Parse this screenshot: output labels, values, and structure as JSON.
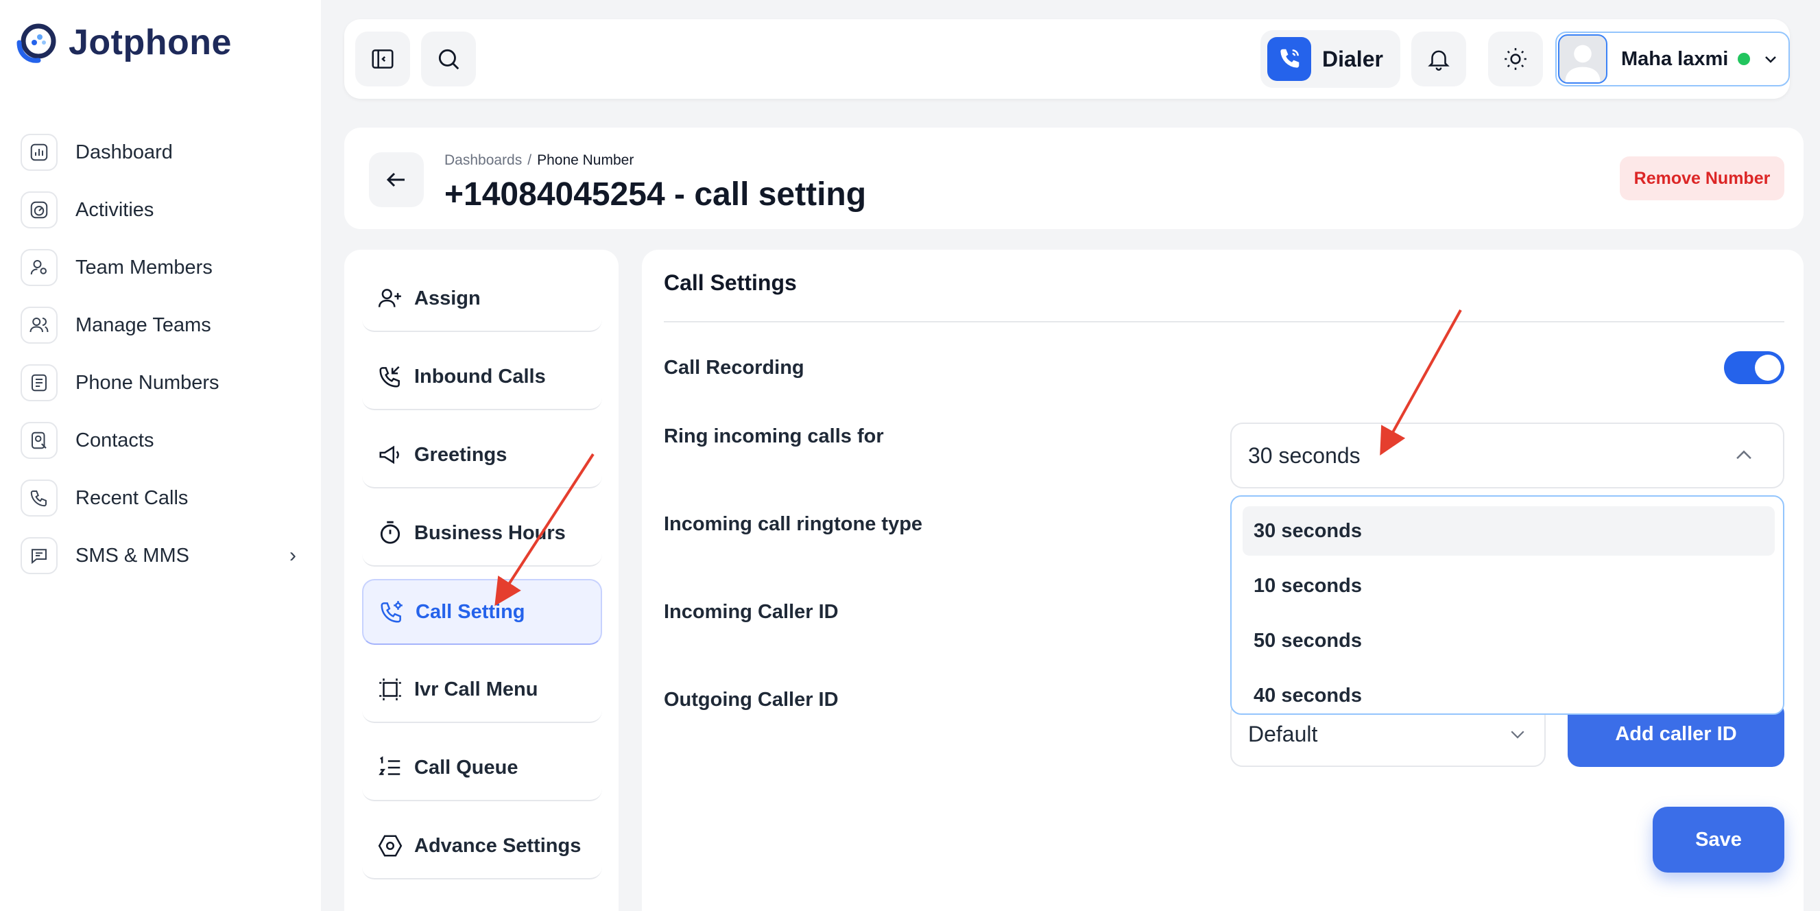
{
  "brand": {
    "name": "Jotphone",
    "accent": "#2563eb"
  },
  "sidebar": {
    "items": [
      {
        "label": "Dashboard",
        "icon": "chart-icon"
      },
      {
        "label": "Activities",
        "icon": "speedometer-icon"
      },
      {
        "label": "Team Members",
        "icon": "user-settings-icon"
      },
      {
        "label": "Manage Teams",
        "icon": "users-icon"
      },
      {
        "label": "Phone Numbers",
        "icon": "phonebook-icon"
      },
      {
        "label": "Contacts",
        "icon": "contact-search-icon"
      },
      {
        "label": "Recent Calls",
        "icon": "phone-history-icon"
      },
      {
        "label": "SMS & MMS",
        "icon": "message-icon"
      }
    ]
  },
  "topbar": {
    "dialer_label": "Dialer",
    "user_name": "Maha laxmi",
    "user_status_color": "#22c55e"
  },
  "header": {
    "breadcrumb_root": "Dashboards",
    "breadcrumb_current": "Phone Number",
    "title": "+14084045254 - call setting",
    "remove_label": "Remove Number"
  },
  "tabs": [
    {
      "label": "Assign",
      "icon": "user-plus-icon"
    },
    {
      "label": "Inbound Calls",
      "icon": "phone-incoming-icon"
    },
    {
      "label": "Greetings",
      "icon": "megaphone-icon"
    },
    {
      "label": "Business Hours",
      "icon": "timer-icon"
    },
    {
      "label": "Call Setting",
      "icon": "phone-gear-icon",
      "active": true
    },
    {
      "label": "Ivr Call Menu",
      "icon": "frame-icon"
    },
    {
      "label": "Call Queue",
      "icon": "numbered-list-icon"
    },
    {
      "label": "Advance Settings",
      "icon": "hexagon-icon"
    }
  ],
  "settings": {
    "title": "Call Settings",
    "call_recording_label": "Call Recording",
    "call_recording_on": true,
    "ring_label": "Ring incoming calls for",
    "ring_value": "30 seconds",
    "ringtone_label": "Incoming call ringtone type",
    "incoming_caller_label": "Incoming Caller ID",
    "outgoing_caller_label": "Outgoing Caller ID",
    "outgoing_caller_value": "Default",
    "add_caller_label": "Add caller ID",
    "save_label": "Save",
    "ring_options": [
      "30 seconds",
      "10 seconds",
      "50 seconds",
      "40 seconds"
    ]
  },
  "annotation_color": "#e53e2e"
}
